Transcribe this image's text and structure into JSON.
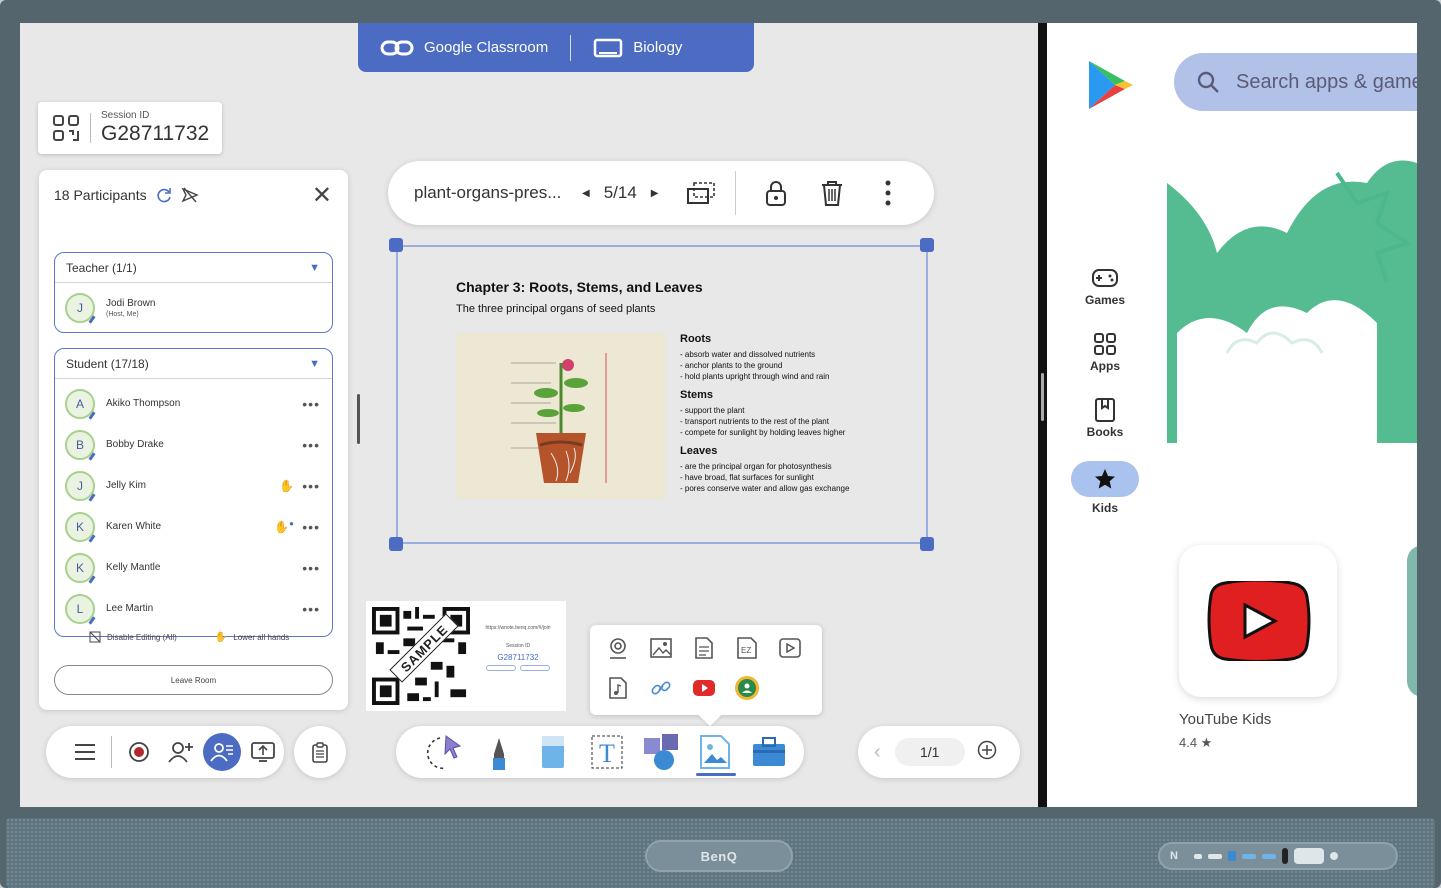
{
  "device": {
    "brand": "BenQ"
  },
  "banner": {
    "classroom_label": "Google Classroom",
    "class_label": "Biology"
  },
  "session": {
    "label": "Session ID",
    "id": "G28711732"
  },
  "participants": {
    "title": "18 Participants",
    "teacher_group": {
      "label": "Teacher (1/1)",
      "members": [
        {
          "initial": "J",
          "name": "Jodi Brown",
          "role": "(Host, Me)"
        }
      ]
    },
    "student_group": {
      "label": "Student (17/18)",
      "members": [
        {
          "initial": "A",
          "name": "Akiko Thompson",
          "hand": ""
        },
        {
          "initial": "B",
          "name": "Bobby Drake",
          "hand": ""
        },
        {
          "initial": "J",
          "name": "Jelly Kim",
          "hand": "lower-hand-icon"
        },
        {
          "initial": "K",
          "name": "Karen White",
          "hand": "raised-hand-icon"
        },
        {
          "initial": "K",
          "name": "Kelly Mantle",
          "hand": ""
        },
        {
          "initial": "L",
          "name": "Lee Martin",
          "hand": ""
        }
      ]
    },
    "disable_editing": "Disable Editing (All)",
    "lower_hands": "Lower all hands",
    "leave_room": "Leave Room"
  },
  "toolbar": {
    "file_name": "plant-organs-pres...",
    "page": "5/14"
  },
  "slide": {
    "title": "Chapter 3: Roots, Stems, and Leaves",
    "subtitle": "The three principal organs of seed plants",
    "sections": [
      {
        "heading": "Roots",
        "lines": [
          "- absorb water and dissolved nutrients",
          "- anchor plants to the ground",
          "- hold plants upright through wind and rain"
        ]
      },
      {
        "heading": "Stems",
        "lines": [
          "- support the plant",
          "- transport nutrients to the rest of the plant",
          "- compete for sunlight by holding leaves higher"
        ]
      },
      {
        "heading": "Leaves",
        "lines": [
          "- are the principal organ for photosynthesis",
          "- have broad, flat surfaces for sunlight",
          "- pores conserve water and allow gas exchange"
        ]
      }
    ]
  },
  "qr_card": {
    "watermark": "SAMPLE",
    "url": "https://wnote.benq.com/#/join",
    "session_label": "Session ID",
    "session_id": "G28711732"
  },
  "insert_popup": {
    "items": [
      "webcam-icon",
      "image-icon",
      "document-icon",
      "ez-icon",
      "video-icon",
      "audio-icon",
      "link-icon",
      "youtube-icon",
      "classroom-icon"
    ]
  },
  "page_nav": {
    "page": "1/1"
  },
  "play_store": {
    "search_placeholder": "Search apps & games",
    "nav": [
      {
        "label": "Games",
        "icon": "gamepad-icon"
      },
      {
        "label": "Apps",
        "icon": "apps-grid-icon"
      },
      {
        "label": "Books",
        "icon": "book-icon"
      },
      {
        "label": "Kids",
        "icon": "star-icon"
      }
    ],
    "featured_app": {
      "name": "YouTube Kids",
      "rating": "4.4 ★"
    },
    "colors": {
      "accent": "#4b6cc2",
      "kids_pill": "#a9c2ee",
      "hero_green": "#4cb88c"
    }
  }
}
